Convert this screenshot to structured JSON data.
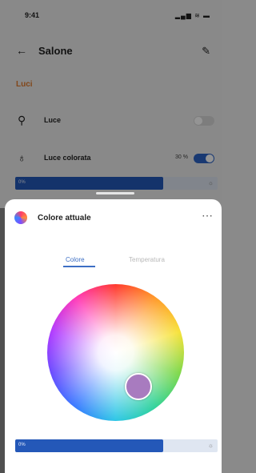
{
  "status_bar": {
    "time": "9:41",
    "icons_text": "▂▄▆ ≋ ▬"
  },
  "header": {
    "back_icon": "←",
    "title": "Salone",
    "edit_icon": "✎"
  },
  "section_label": "Luci",
  "rows": [
    {
      "icon": "lamp-icon",
      "icon_glyph": "⚲",
      "label": "Luce",
      "toggle": "off"
    },
    {
      "icon": "bulb-icon",
      "icon_glyph": "♁",
      "label": "Luce colorata",
      "value_text": "30 %",
      "toggle": "on"
    }
  ],
  "brightness_slider": {
    "low_label": "0%",
    "high_label": "☼",
    "level_percent": 73
  },
  "sheet": {
    "title": "Colore attuale",
    "more_icon": "⋯",
    "tabs": [
      {
        "label": "Colore",
        "active": true
      },
      {
        "label": "Temperatura",
        "active": false
      }
    ],
    "selected_color": "#a87bbf",
    "bottom_slider": {
      "low_label": "0%",
      "high_label": "☼",
      "level_percent": 73
    }
  },
  "colors": {
    "accent": "#2458b8",
    "tab_active": "#3d6fc4",
    "section": "#e07a2c"
  }
}
